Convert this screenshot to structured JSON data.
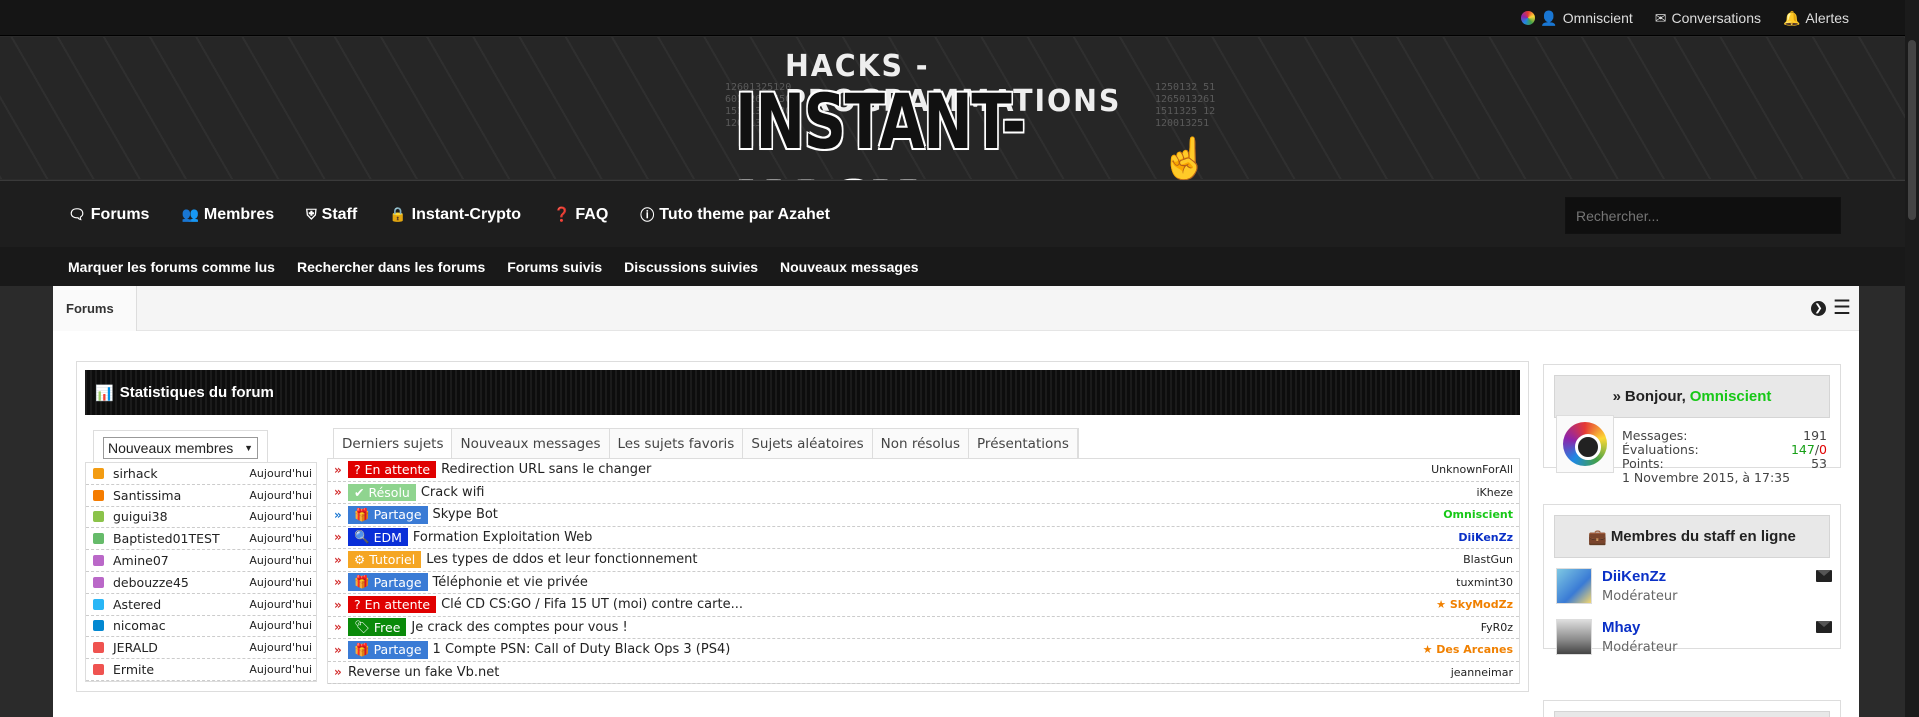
{
  "topbar": {
    "user": "Omniscient",
    "conversations": "Conversations",
    "alerts": "Alertes"
  },
  "logo": {
    "subtitle": "HACKS - PROGRAMMATIONS",
    "title": "INSTANT-HACK",
    "binary_left": [
      "12601325120",
      "60132612650",
      "15111325120",
      "120013251"
    ],
    "binary_right": [
      "1250132 51",
      "1265013261",
      "1511325 12",
      "120013251"
    ]
  },
  "nav": {
    "tabs": [
      {
        "label": "Forums",
        "icon": "comments-icon"
      },
      {
        "label": "Membres",
        "icon": "users-icon"
      },
      {
        "label": "Staff",
        "icon": "shield-icon"
      },
      {
        "label": "Instant-Crypto",
        "icon": "lock-icon"
      },
      {
        "label": "FAQ",
        "icon": "question-icon"
      },
      {
        "label": "Tuto theme par Azahet",
        "icon": "info-icon"
      }
    ],
    "search_placeholder": "Rechercher..."
  },
  "subnav": [
    "Marquer les forums comme lus",
    "Rechercher dans les forums",
    "Forums suivis",
    "Discussions suivies",
    "Nouveaux messages"
  ],
  "breadcrumb": "Forums",
  "stats": {
    "title": "Statistiques du forum",
    "members_select": "Nouveaux membres",
    "members": [
      {
        "name": "sirhack",
        "date": "Aujourd'hui",
        "color": "#f39c12"
      },
      {
        "name": "Santissima",
        "date": "Aujourd'hui",
        "color": "#f57c00"
      },
      {
        "name": "guigui38",
        "date": "Aujourd'hui",
        "color": "#8bc34a"
      },
      {
        "name": "Baptisted01TEST",
        "date": "Aujourd'hui",
        "color": "#66bb6a"
      },
      {
        "name": "Amine07",
        "date": "Aujourd'hui",
        "color": "#ba68c8"
      },
      {
        "name": "debouzze45",
        "date": "Aujourd'hui",
        "color": "#ba68c8"
      },
      {
        "name": "Astered",
        "date": "Aujourd'hui",
        "color": "#29b6f6"
      },
      {
        "name": "nicomac",
        "date": "Aujourd'hui",
        "color": "#0288d1"
      },
      {
        "name": "JERALD",
        "date": "Aujourd'hui",
        "color": "#ef5350"
      },
      {
        "name": "Ermite",
        "date": "Aujourd'hui",
        "color": "#ef5350"
      }
    ],
    "tabs": [
      "Derniers sujets",
      "Nouveaux messages",
      "Les sujets favoris",
      "Sujets aléatoires",
      "Non résolus",
      "Présentations"
    ],
    "threads": [
      {
        "prefix": "En attente",
        "prefix_icon": "?",
        "prefix_color": "#e00000",
        "title": "Redirection URL sans le changer",
        "author": "UnknownForAll",
        "author_color": "#222",
        "arrow_color": "#d32f2f"
      },
      {
        "prefix": "Résolu",
        "prefix_icon": "✔",
        "prefix_color": "#8fd48f",
        "title": "Crack wifi",
        "author": "iKheze",
        "author_color": "#222",
        "arrow_color": "#d32f2f"
      },
      {
        "prefix": "Partage",
        "prefix_icon": "🎁",
        "prefix_color": "#3a7bd5",
        "title": "Skype Bot",
        "author": "Omniscient",
        "author_color": "#17c817",
        "arrow_color": "#1976d2"
      },
      {
        "prefix": "EDM",
        "prefix_icon": "🔍",
        "prefix_color": "#0a2fd8",
        "title": "Formation Exploitation Web",
        "author": "DiiKenZz",
        "author_color": "#0a30c7",
        "arrow_color": "#d32f2f"
      },
      {
        "prefix": "Tutoriel",
        "prefix_icon": "⚙",
        "prefix_color": "#f5a623",
        "title": "Les types de ddos et leur fonctionnement",
        "author": "BlastGun",
        "author_color": "#222",
        "arrow_color": "#d32f2f"
      },
      {
        "prefix": "Partage",
        "prefix_icon": "🎁",
        "prefix_color": "#3a7bd5",
        "title": "Téléphonie et vie privée",
        "author": "tuxmint30",
        "author_color": "#222",
        "arrow_color": "#d32f2f"
      },
      {
        "prefix": "En attente",
        "prefix_icon": "?",
        "prefix_color": "#e00000",
        "title": "Clé CD CS:GO / Fifa 15 UT (moi) contre carte...",
        "author": "★ SkyModZz",
        "author_color": "#f08000",
        "arrow_color": "#d32f2f"
      },
      {
        "prefix": "Free",
        "prefix_icon": "🏷",
        "prefix_color": "#0a8a0a",
        "title": "Je crack des comptes pour vous !",
        "author": "FyR0z",
        "author_color": "#222",
        "arrow_color": "#d32f2f"
      },
      {
        "prefix": "Partage",
        "prefix_icon": "🎁",
        "prefix_color": "#3a7bd5",
        "title": "1 Compte PSN: Call of Duty Black Ops 3 (PS4)",
        "author": "★ Des Arcanes",
        "author_color": "#f08000",
        "arrow_color": "#d32f2f"
      },
      {
        "prefix": "",
        "prefix_icon": "",
        "prefix_color": "",
        "title": "Reverse un fake Vb.net",
        "author": "jeanneimar",
        "author_color": "#222",
        "arrow_color": "#d32f2f"
      }
    ]
  },
  "welcome": {
    "greeting": "Bonjour,",
    "user": "Omniscient",
    "messages_label": "Messages:",
    "messages_value": "191",
    "evals_label": "Évaluations:",
    "evals_pos": "147",
    "evals_sep": "/",
    "evals_neg": "0",
    "points_label": "Points:",
    "points_value": "53",
    "joined": "1 Novembre 2015, à 17:35"
  },
  "staff": {
    "title": "Membres du staff en ligne",
    "members": [
      {
        "name": "DiiKenZz",
        "role": "Modérateur"
      },
      {
        "name": "Mhay",
        "role": "Modérateur"
      }
    ]
  },
  "colors": {
    "accent_green": "#17c817",
    "staff_blue": "#0a30c7"
  }
}
